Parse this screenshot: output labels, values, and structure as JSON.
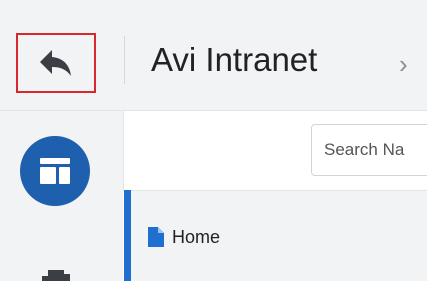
{
  "header": {
    "back_icon": "back-arrow-icon",
    "title": "Avi Intranet",
    "chevron": "›"
  },
  "rail": {
    "primary_icon": "layout-icon",
    "secondary_icon": "pages-icon"
  },
  "search": {
    "placeholder": "Search Na"
  },
  "nav": {
    "items": [
      {
        "label": "Home",
        "icon": "page-icon"
      }
    ]
  },
  "colors": {
    "accent": "#1e6fd0",
    "highlight_border": "#d9272e",
    "rail_button": "#1e5fae"
  }
}
